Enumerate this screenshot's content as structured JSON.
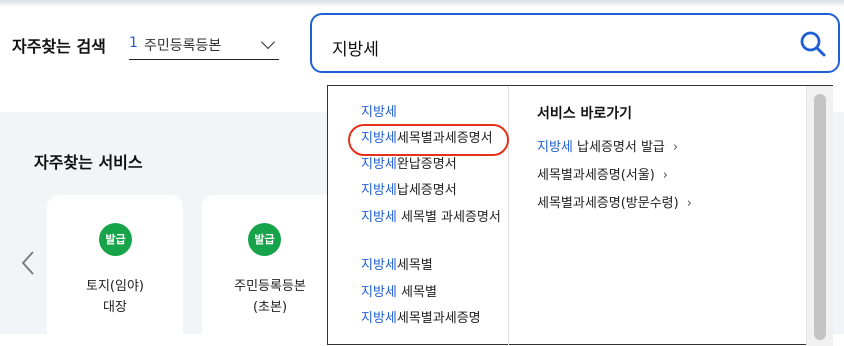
{
  "frequent_search": {
    "label": "자주찾는 검색",
    "number": "1",
    "selected": "주민등록등본"
  },
  "search": {
    "value": "지방세"
  },
  "services": {
    "title": "자주찾는 서비스",
    "cards": [
      {
        "badge": "발급",
        "line1": "토지(임야)",
        "line2": "대장"
      },
      {
        "badge": "발급",
        "line1": "주민등록등본",
        "line2": "(초본)"
      }
    ]
  },
  "suggestions": {
    "keyword": "지방세",
    "items": [
      {
        "rest": ""
      },
      {
        "rest": "세목별과세증명서"
      },
      {
        "rest": "완납증명서"
      },
      {
        "rest": "납세증명서"
      },
      {
        "rest": " 세목별 과세증명서"
      },
      {
        "rest": "세목별"
      },
      {
        "rest": " 세목별"
      },
      {
        "rest": "세목별과세증명"
      }
    ]
  },
  "quick": {
    "title": "서비스 바로가기",
    "links": [
      {
        "hl": "지방세",
        "rest": " 납세증명서 발급",
        "arrow": "›"
      },
      {
        "hl": "",
        "rest": "세목별과세증명(서울)",
        "arrow": "›"
      },
      {
        "hl": "",
        "rest": "세목별과세증명(방문수령)",
        "arrow": "›"
      }
    ]
  }
}
